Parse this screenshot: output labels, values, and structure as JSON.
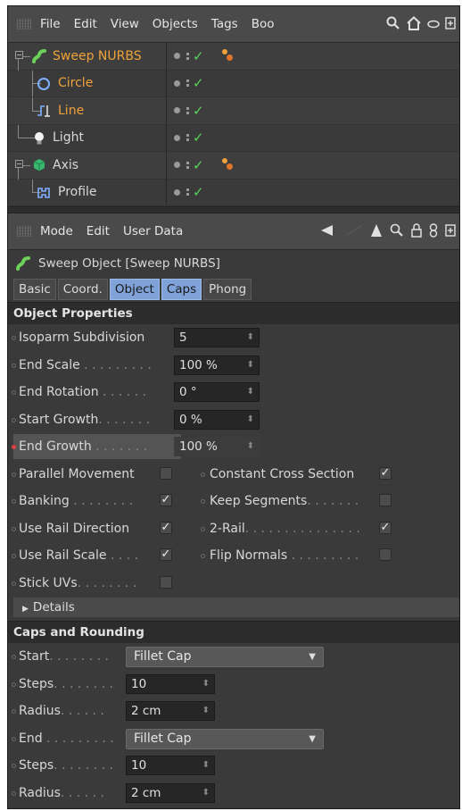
{
  "object_manager": {
    "menu": [
      "File",
      "Edit",
      "View",
      "Objects",
      "Tags",
      "Boo"
    ],
    "objects": [
      {
        "name": "Sweep NURBS",
        "color": "#f0a23a",
        "icon": "sweep-nurbs-icon",
        "has_tag": true
      },
      {
        "name": "Circle",
        "color": "#f0a23a",
        "icon": "circle-spline-icon",
        "has_tag": false
      },
      {
        "name": "Line",
        "color": "#f0a23a",
        "icon": "line-spline-icon",
        "has_tag": false
      },
      {
        "name": "Light",
        "color": "#d8d8d8",
        "icon": "light-icon",
        "has_tag": false
      },
      {
        "name": "Axis",
        "color": "#d8d8d8",
        "icon": "null-object-icon",
        "has_tag": true
      },
      {
        "name": "Profile",
        "color": "#d8d8d8",
        "icon": "profile-spline-icon",
        "has_tag": false
      }
    ]
  },
  "attribute_manager": {
    "menu": [
      "Mode",
      "Edit",
      "User Data"
    ],
    "title": "Sweep Object [Sweep NURBS]",
    "tabs": [
      {
        "label": "Basic",
        "active": false
      },
      {
        "label": "Coord.",
        "active": false
      },
      {
        "label": "Object",
        "active": true
      },
      {
        "label": "Caps",
        "active": true
      },
      {
        "label": "Phong",
        "active": false
      }
    ],
    "object_properties": {
      "heading": "Object Properties",
      "isoparm_label": "Isoparm Subdivision",
      "isoparm_value": "5",
      "end_scale_label": "End Scale",
      "end_scale_value": "100 %",
      "end_rotation_label": "End Rotation",
      "end_rotation_value": "0 °",
      "start_growth_label": "Start Growth",
      "start_growth_value": "0 %",
      "end_growth_label": "End Growth",
      "end_growth_value": "100 %",
      "checkboxes_left": [
        {
          "label": "Parallel Movement",
          "checked": false
        },
        {
          "label": "Banking",
          "checked": true
        },
        {
          "label": "Use Rail Direction",
          "checked": true
        },
        {
          "label": "Use Rail Scale",
          "checked": true
        },
        {
          "label": "Stick UVs",
          "checked": false
        }
      ],
      "checkboxes_right": [
        {
          "label": "Constant Cross Section",
          "checked": true
        },
        {
          "label": "Keep Segments",
          "checked": false
        },
        {
          "label": "2-Rail",
          "checked": true
        },
        {
          "label": "Flip Normals",
          "checked": false
        }
      ],
      "details_label": "Details"
    },
    "caps": {
      "heading": "Caps and Rounding",
      "start_label": "Start",
      "start_value": "Fillet Cap",
      "steps1_label": "Steps",
      "steps1_value": "10",
      "radius1_label": "Radius",
      "radius1_value": "2 cm",
      "end_label": "End",
      "end_value": "Fillet Cap",
      "steps2_label": "Steps",
      "steps2_value": "10",
      "radius2_label": "Radius",
      "radius2_value": "2 cm"
    }
  }
}
